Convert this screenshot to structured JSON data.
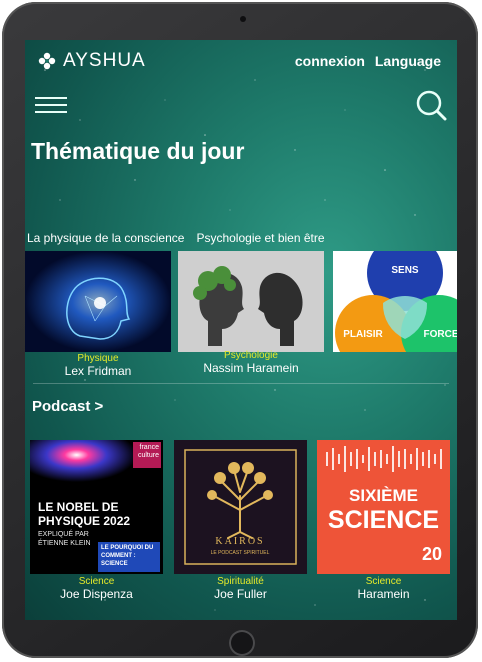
{
  "header": {
    "brand": "AYSHUA",
    "links": [
      "connexion",
      "Language"
    ]
  },
  "section_title": "Thématique du jour",
  "categories": [
    "La physique de la conscience",
    "Psychologie et bien être"
  ],
  "featured": [
    {
      "category": "Physique",
      "name": "Lex Fridman"
    },
    {
      "category": "Psychologie",
      "name": "Nassim Haramein"
    }
  ],
  "venn": {
    "top": "SENS",
    "left": "PLAISIR",
    "right": "FORCE"
  },
  "podcast_heading": "Podcast >",
  "podcasts": [
    {
      "category": "Science",
      "name": "Joe Dispenza"
    },
    {
      "category": "Spiritualité",
      "name": "Joe Fuller"
    },
    {
      "category": "Science",
      "name": "Haramein"
    }
  ],
  "covers": {
    "nobel": {
      "title": "LE NOBEL DE PHYSIQUE 2022",
      "subtitle": "EXPLIQUÉ PAR ÉTIENNE KLEIN",
      "box": "LE POURQUOI DU COMMENT : SCIENCE",
      "badge": "france culture"
    },
    "kairos": {
      "title": "KAIROS",
      "subtitle": "LE PODCAST SPIRITUEL"
    },
    "sixieme": {
      "line1": "SIXIÈME",
      "line2": "SCIENCE",
      "badge": "20"
    }
  },
  "colors": {
    "accent": "#e5ea2a",
    "screen": "#1e7a6a"
  }
}
